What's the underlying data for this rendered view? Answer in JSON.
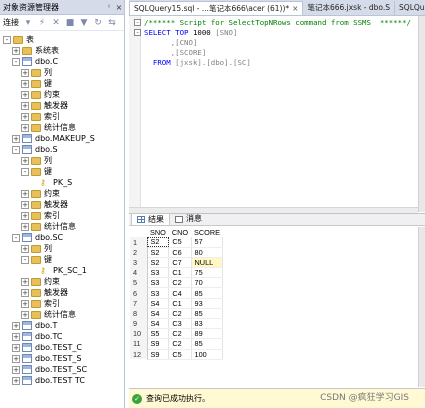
{
  "explorer": {
    "title": "对象资源管理器",
    "pin": "ᴵ",
    "close": "×",
    "connect_label": "连接",
    "tree": [
      {
        "label": "表",
        "kind": "folder",
        "indent": 0,
        "expander": "-"
      },
      {
        "label": "系统表",
        "kind": "folder",
        "indent": 1,
        "expander": "+"
      },
      {
        "label": "dbo.C",
        "kind": "table",
        "indent": 1,
        "expander": "-"
      },
      {
        "label": "列",
        "kind": "folder",
        "indent": 2,
        "expander": "+"
      },
      {
        "label": "键",
        "kind": "folder",
        "indent": 2,
        "expander": "+"
      },
      {
        "label": "约束",
        "kind": "folder",
        "indent": 2,
        "expander": "+"
      },
      {
        "label": "触发器",
        "kind": "folder",
        "indent": 2,
        "expander": "+"
      },
      {
        "label": "索引",
        "kind": "folder",
        "indent": 2,
        "expander": "+"
      },
      {
        "label": "统计信息",
        "kind": "folder",
        "indent": 2,
        "expander": "+"
      },
      {
        "label": "dbo.MAKEUP_S",
        "kind": "table",
        "indent": 1,
        "expander": "+"
      },
      {
        "label": "dbo.S",
        "kind": "table",
        "indent": 1,
        "expander": "-"
      },
      {
        "label": "列",
        "kind": "folder",
        "indent": 2,
        "expander": "+"
      },
      {
        "label": "键",
        "kind": "folder",
        "indent": 2,
        "expander": "-"
      },
      {
        "label": "PK_S",
        "kind": "key",
        "indent": 3,
        "expander": ""
      },
      {
        "label": "约束",
        "kind": "folder",
        "indent": 2,
        "expander": "+"
      },
      {
        "label": "触发器",
        "kind": "folder",
        "indent": 2,
        "expander": "+"
      },
      {
        "label": "索引",
        "kind": "folder",
        "indent": 2,
        "expander": "+"
      },
      {
        "label": "统计信息",
        "kind": "folder",
        "indent": 2,
        "expander": "+"
      },
      {
        "label": "dbo.SC",
        "kind": "table",
        "indent": 1,
        "expander": "-"
      },
      {
        "label": "列",
        "kind": "folder",
        "indent": 2,
        "expander": "+"
      },
      {
        "label": "键",
        "kind": "folder",
        "indent": 2,
        "expander": "-"
      },
      {
        "label": "PK_SC_1",
        "kind": "key",
        "indent": 3,
        "expander": ""
      },
      {
        "label": "约束",
        "kind": "folder",
        "indent": 2,
        "expander": "+"
      },
      {
        "label": "触发器",
        "kind": "folder",
        "indent": 2,
        "expander": "+"
      },
      {
        "label": "索引",
        "kind": "folder",
        "indent": 2,
        "expander": "+"
      },
      {
        "label": "统计信息",
        "kind": "folder",
        "indent": 2,
        "expander": "+"
      },
      {
        "label": "dbo.T",
        "kind": "table",
        "indent": 1,
        "expander": "+"
      },
      {
        "label": "dbo.TC",
        "kind": "table",
        "indent": 1,
        "expander": "+"
      },
      {
        "label": "dbo.TEST_C",
        "kind": "table",
        "indent": 1,
        "expander": "+"
      },
      {
        "label": "dbo.TEST_S",
        "kind": "table",
        "indent": 1,
        "expander": "+"
      },
      {
        "label": "dbo.TEST_SC",
        "kind": "table",
        "indent": 1,
        "expander": "+"
      },
      {
        "label": "dbo.TEST TC",
        "kind": "table",
        "indent": 1,
        "expander": "+"
      }
    ]
  },
  "tabs": [
    {
      "label": "SQLQuery15.sql - ...笔记本666\\acer (61))*",
      "close": "×",
      "active": true
    },
    {
      "label": "笔记本666.jxsk - dbo.S",
      "close": "",
      "active": false
    },
    {
      "label": "SQLQuery10.sql - ...",
      "close": "",
      "active": false
    }
  ],
  "editor": {
    "lines": [
      [
        {
          "t": "/****** Script for SelectTopNRows command from SSMS  ******/",
          "c": "c-comment"
        }
      ],
      [
        {
          "t": "SELECT TOP ",
          "c": "c-kw"
        },
        {
          "t": "1000 ",
          "c": ""
        },
        {
          "t": "[SNO]",
          "c": "c-id"
        }
      ],
      [
        {
          "t": "      ,",
          "c": "c-pl"
        },
        {
          "t": "[CNO]",
          "c": "c-id"
        }
      ],
      [
        {
          "t": "      ,",
          "c": "c-pl"
        },
        {
          "t": "[SCORE]",
          "c": "c-id"
        }
      ],
      [
        {
          "t": "  FROM ",
          "c": "c-kw"
        },
        {
          "t": "[jxsk]",
          "c": "c-id"
        },
        {
          "t": ".",
          "c": "c-pl"
        },
        {
          "t": "[dbo]",
          "c": "c-id"
        },
        {
          "t": ".",
          "c": "c-pl"
        },
        {
          "t": "[SC]",
          "c": "c-id"
        }
      ]
    ]
  },
  "results": {
    "tab_results": "结果",
    "tab_messages": "消息",
    "columns": [
      "SNO",
      "CNO",
      "SCORE"
    ],
    "rows": [
      [
        "1",
        "S2",
        "C5",
        "57"
      ],
      [
        "2",
        "S2",
        "C6",
        "80"
      ],
      [
        "3",
        "S2",
        "C7",
        "NULL"
      ],
      [
        "4",
        "S3",
        "C1",
        "75"
      ],
      [
        "5",
        "S3",
        "C2",
        "70"
      ],
      [
        "6",
        "S3",
        "C4",
        "85"
      ],
      [
        "7",
        "S4",
        "C1",
        "93"
      ],
      [
        "8",
        "S4",
        "C2",
        "85"
      ],
      [
        "9",
        "S4",
        "C3",
        "83"
      ],
      [
        "10",
        "S5",
        "C2",
        "89"
      ],
      [
        "11",
        "S9",
        "C2",
        "85"
      ],
      [
        "12",
        "S9",
        "C5",
        "100"
      ]
    ]
  },
  "status": {
    "message": "查询已成功执行。",
    "ok_glyph": "✓"
  },
  "watermark": "CSDN @疯狂学习GIS"
}
